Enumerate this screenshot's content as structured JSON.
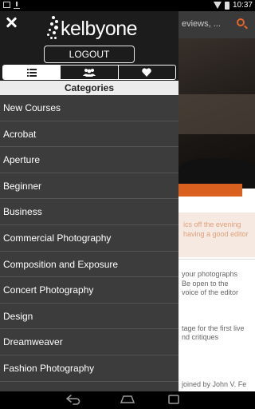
{
  "status_bar": {
    "time": "10:37"
  },
  "background": {
    "title": "eviews, ...",
    "highlight_lines": [
      "ics off the evening",
      "having a good editor"
    ],
    "text_lines": [
      "your photographs",
      "Be open to the",
      "voice of the editor",
      "tage for the first live",
      "nd critiques",
      "joined by John V. Fe"
    ]
  },
  "drawer": {
    "logo_text": "kelbyone",
    "logout_label": "LOGOUT",
    "tabs": [
      {
        "name": "list"
      },
      {
        "name": "people"
      },
      {
        "name": "favorites"
      }
    ],
    "categories_header": "Categories",
    "categories": [
      "New Courses",
      "Acrobat",
      "Aperture",
      "Beginner",
      "Business",
      "Commercial Photography",
      "Composition and Exposure",
      "Concert Photography",
      "Design",
      "Dreamweaver",
      "Fashion Photography"
    ]
  },
  "colors": {
    "accent": "#e8652a",
    "drawer_bg": "#3c3c3c",
    "header_bg": "#1c1c1c"
  }
}
